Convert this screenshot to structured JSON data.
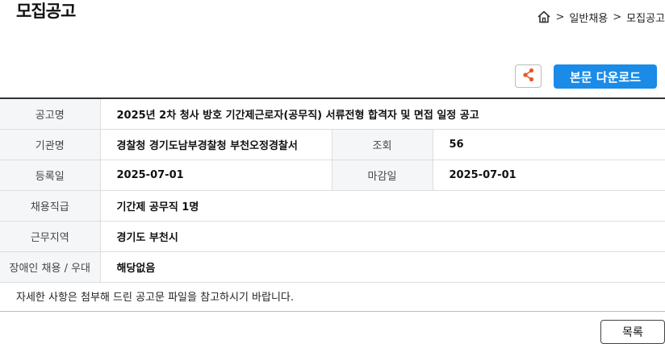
{
  "page_title": "모집공고",
  "breadcrumb": {
    "icon": "home-icon",
    "separator": ">",
    "items": [
      "일반채용",
      "모집공고"
    ]
  },
  "actions": {
    "share_icon": "share-icon",
    "download_label": "본문 다운로드",
    "accent_color": "#1a8be6"
  },
  "details": {
    "title_label": "공고명",
    "title_value": "2025년 2차 청사 방호 기간제근로자(공무직) 서류전형 합격자 및 면접 일정 공고",
    "agency_label": "기관명",
    "agency_value": "경찰청 경기도남부경찰청 부천오정경찰서",
    "views_label": "조회",
    "views_value": "56",
    "registered_label": "등록일",
    "registered_value": "2025-07-01",
    "deadline_label": "마감일",
    "deadline_value": "2025-07-01",
    "job_grade_label": "채용직급",
    "job_grade_value": "기간제 공무직 1명",
    "location_label": "근무지역",
    "location_value": "경기도 부천시",
    "disability_label": "장애인 채용 / 우대",
    "disability_value": "해당없음"
  },
  "note": "자세한 사항은 첨부해 드린 공고문 파일을 참고하시기 바랍니다.",
  "list_button_label": "목록"
}
